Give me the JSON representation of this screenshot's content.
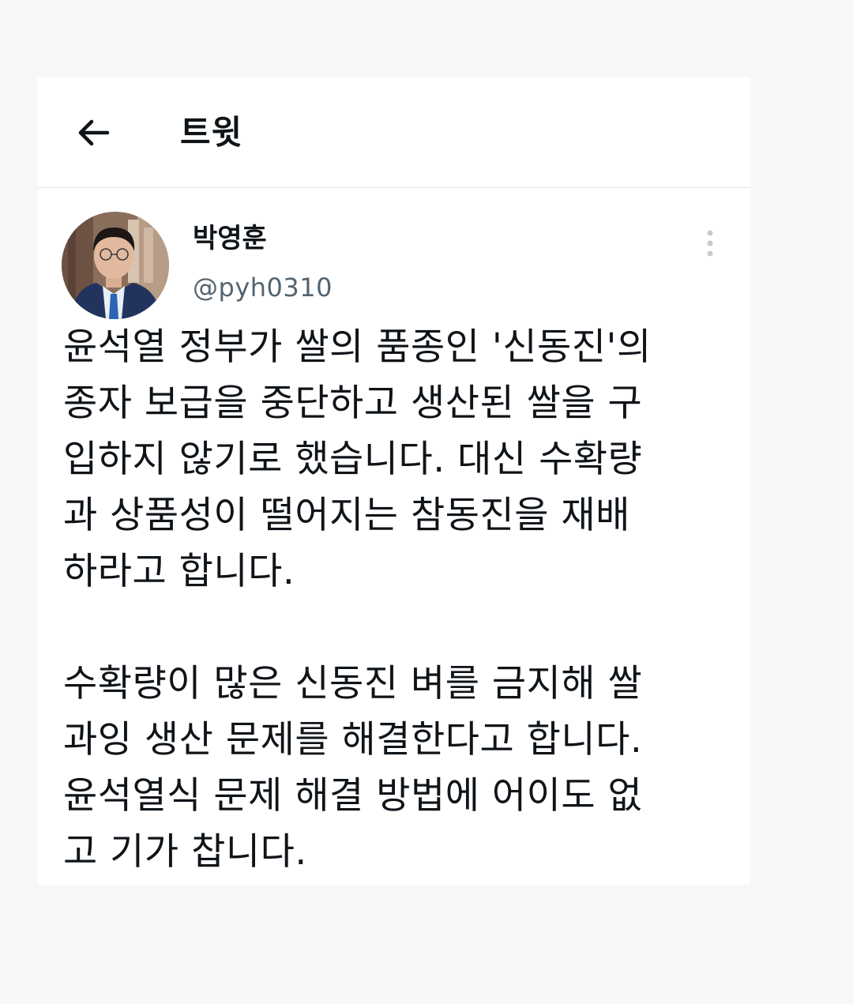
{
  "header": {
    "title": "트윗",
    "back_icon": "arrow-left-icon"
  },
  "author": {
    "display_name": "박영훈",
    "handle": "@pyh0310",
    "avatar_icon": "avatar-photo"
  },
  "more_icon": "more-vertical-icon",
  "tweet": {
    "text": "윤석열 정부가 쌀의 품종인 '신동진'의\n종자 보급을 중단하고 생산된 쌀을 구\n입하지 않기로 했습니다. 대신 수확량\n과 상품성이 떨어지는 참동진을 재배\n하라고 합니다.\n\n수확량이 많은 신동진 벼를 금지해 쌀\n과잉 생산 문제를 해결한다고 합니다.\n윤석열식 문제 해결 방법에 어이도 없\n고 기가 찹니다."
  },
  "colors": {
    "background": "#f7f7f7",
    "card": "#ffffff",
    "text": "#0f1419",
    "secondary_text": "#536471",
    "divider": "#e6e6e6"
  }
}
